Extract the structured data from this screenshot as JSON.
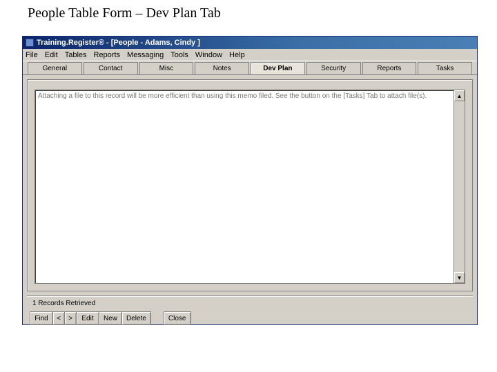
{
  "caption": "People Table Form – Dev Plan Tab",
  "titlebar": {
    "text": "Training.Register® - [People - Adams, Cindy ]"
  },
  "menubar": {
    "items": [
      "File",
      "Edit",
      "Tables",
      "Reports",
      "Messaging",
      "Tools",
      "Window",
      "Help"
    ]
  },
  "tabs": {
    "items": [
      {
        "label": "General",
        "u": "G"
      },
      {
        "label": "Contact",
        "u": "C"
      },
      {
        "label": "Misc",
        "u": "M"
      },
      {
        "label": "Notes",
        "u": "N"
      },
      {
        "label": "Dev Plan",
        "u": "D"
      },
      {
        "label": "Security",
        "u": "S"
      },
      {
        "label": "Reports",
        "u": "R"
      },
      {
        "label": "Tasks",
        "u": "T"
      }
    ],
    "active_index": 4
  },
  "memo": {
    "text": "Attaching a file to this record will be more efficient than using this memo filed.  See the button on the [Tasks] Tab to attach file(s)."
  },
  "status": {
    "text": "1 Records Retrieved"
  },
  "buttons": {
    "find": "Find",
    "prev": "<",
    "next": ">",
    "edit": "Edit",
    "new": "New",
    "delete": "Delete",
    "close": "Close"
  }
}
